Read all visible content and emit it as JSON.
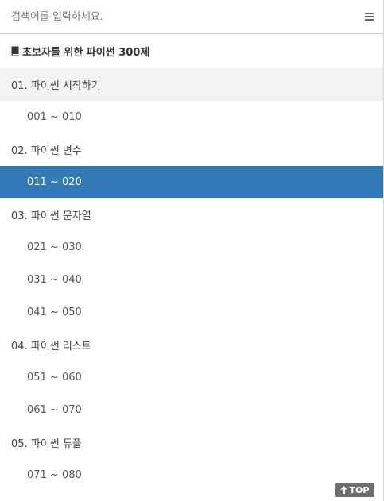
{
  "search": {
    "placeholder": "검색어를 입력하세요."
  },
  "menu": {
    "icon": "hamburger-menu-icon"
  },
  "book": {
    "icon": "book-icon",
    "title": "초보자를 위한 파이썬 300제"
  },
  "nav": {
    "items": [
      {
        "label": "01. 파이썬 시작하기",
        "type": "chapter",
        "current": true
      },
      {
        "label": "001 ~ 010",
        "type": "section"
      },
      {
        "label": "02. 파이썬 변수",
        "type": "chapter"
      },
      {
        "label": "011 ~ 020",
        "type": "section",
        "active": true
      },
      {
        "label": "03. 파이썬 문자열",
        "type": "chapter"
      },
      {
        "label": "021 ~ 030",
        "type": "section"
      },
      {
        "label": "031 ~ 040",
        "type": "section"
      },
      {
        "label": "041 ~ 050",
        "type": "section"
      },
      {
        "label": "04. 파이썬 리스트",
        "type": "chapter"
      },
      {
        "label": "051 ~ 060",
        "type": "section"
      },
      {
        "label": "061 ~ 070",
        "type": "section"
      },
      {
        "label": "05. 파이썬 튜플",
        "type": "chapter"
      },
      {
        "label": "071 ~ 080",
        "type": "section"
      }
    ],
    "active_color": "#337ab7",
    "current_chapter_bg": "#f3f3f3"
  },
  "top_button": {
    "icon": "arrow-up-icon",
    "label": "TOP"
  }
}
